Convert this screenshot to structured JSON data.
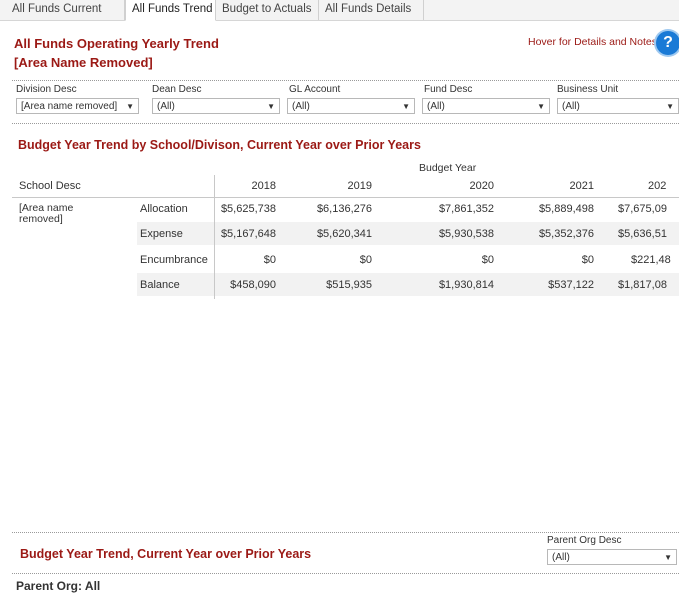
{
  "tabs": [
    {
      "label": "All Funds Current"
    },
    {
      "label": "All Funds Trend"
    },
    {
      "label": "Budget to Actuals"
    },
    {
      "label": "All Funds Details"
    }
  ],
  "header": {
    "title": "All Funds Operating Yearly Trend",
    "subtitle": "[Area Name Removed]",
    "hover_link": "Hover for Details and Notes",
    "help_glyph": "?"
  },
  "filters": [
    {
      "label": "Division Desc",
      "value": "[Area name removed]"
    },
    {
      "label": "Dean Desc",
      "value": "(All)"
    },
    {
      "label": "GL Account",
      "value": "(All)"
    },
    {
      "label": "Fund Desc",
      "value": "(All)"
    },
    {
      "label": "Business Unit",
      "value": "(All)"
    }
  ],
  "table": {
    "title": "Budget Year Trend by School/Divison, Current Year over Prior Years",
    "column_group": "Budget Year",
    "row_header": "School Desc",
    "years": [
      "2018",
      "2019",
      "2020",
      "2021",
      "202"
    ],
    "school": "[Area name removed]",
    "rows": [
      {
        "measure": "Allocation",
        "values": [
          "$5,625,738",
          "$6,136,276",
          "$7,861,352",
          "$5,889,498",
          "$7,675,09"
        ]
      },
      {
        "measure": "Expense",
        "values": [
          "$5,167,648",
          "$5,620,341",
          "$5,930,538",
          "$5,352,376",
          "$5,636,51"
        ]
      },
      {
        "measure": "Encumbrance",
        "values": [
          "$0",
          "$0",
          "$0",
          "$0",
          "$221,48"
        ]
      },
      {
        "measure": "Balance",
        "values": [
          "$458,090",
          "$515,935",
          "$1,930,814",
          "$537,122",
          "$1,817,08"
        ]
      }
    ]
  },
  "bottom": {
    "title": "Budget Year Trend, Current Year over Prior Years",
    "filter_label": "Parent Org Desc",
    "filter_value": "(All)",
    "cutoff_text": "Parent Org: All"
  },
  "colors": {
    "accent": "#9b1915",
    "help": "#1a7ad6",
    "band": "#f2f2f2"
  },
  "icons": {
    "help": "help-circle-icon",
    "dropdown": "chevron-down-icon"
  }
}
